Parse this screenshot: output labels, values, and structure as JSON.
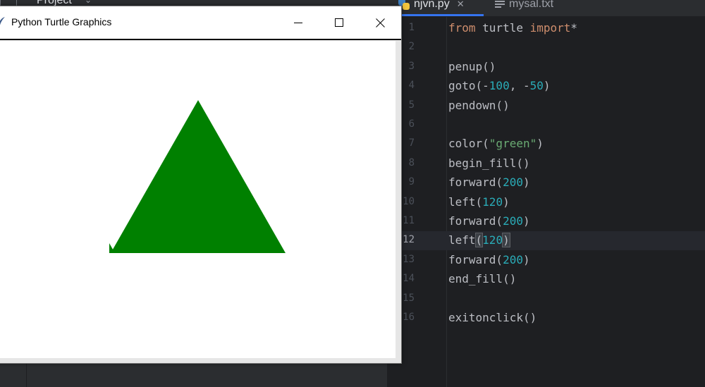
{
  "ide": {
    "project_label": "Project",
    "tabs": [
      {
        "label": "njvn.py",
        "icon": "python-file-icon",
        "active": true
      },
      {
        "label": "mysal.txt",
        "icon": "text-file-icon",
        "active": false
      }
    ],
    "current_line": 12,
    "colors": {
      "editor_bg": "#1e1f22",
      "keyword": "#cf8e6d",
      "number": "#2aacb8",
      "string": "#6aab73",
      "text": "#bcbec4"
    },
    "lines": [
      {
        "n": "1",
        "text": "from turtle import*"
      },
      {
        "n": "2",
        "text": ""
      },
      {
        "n": "3",
        "text": "penup()"
      },
      {
        "n": "4",
        "text": "goto(-100, -50)"
      },
      {
        "n": "5",
        "text": "pendown()"
      },
      {
        "n": "6",
        "text": ""
      },
      {
        "n": "7",
        "text": "color(\"green\")"
      },
      {
        "n": "8",
        "text": "begin_fill()"
      },
      {
        "n": "9",
        "text": "forward(200)"
      },
      {
        "n": "10",
        "text": "left(120)"
      },
      {
        "n": "11",
        "text": "forward(200)"
      },
      {
        "n": "12",
        "text": "left(120)"
      },
      {
        "n": "13",
        "text": "forward(200)"
      },
      {
        "n": "14",
        "text": "end_fill()"
      },
      {
        "n": "15",
        "text": ""
      },
      {
        "n": "16",
        "text": "exitonclick()"
      }
    ]
  },
  "turtle_window": {
    "title": "Python Turtle Graphics",
    "minimize_icon": "minimize-icon",
    "maximize_icon": "maximize-icon",
    "close_icon": "close-icon",
    "fill_color": "#008000"
  }
}
